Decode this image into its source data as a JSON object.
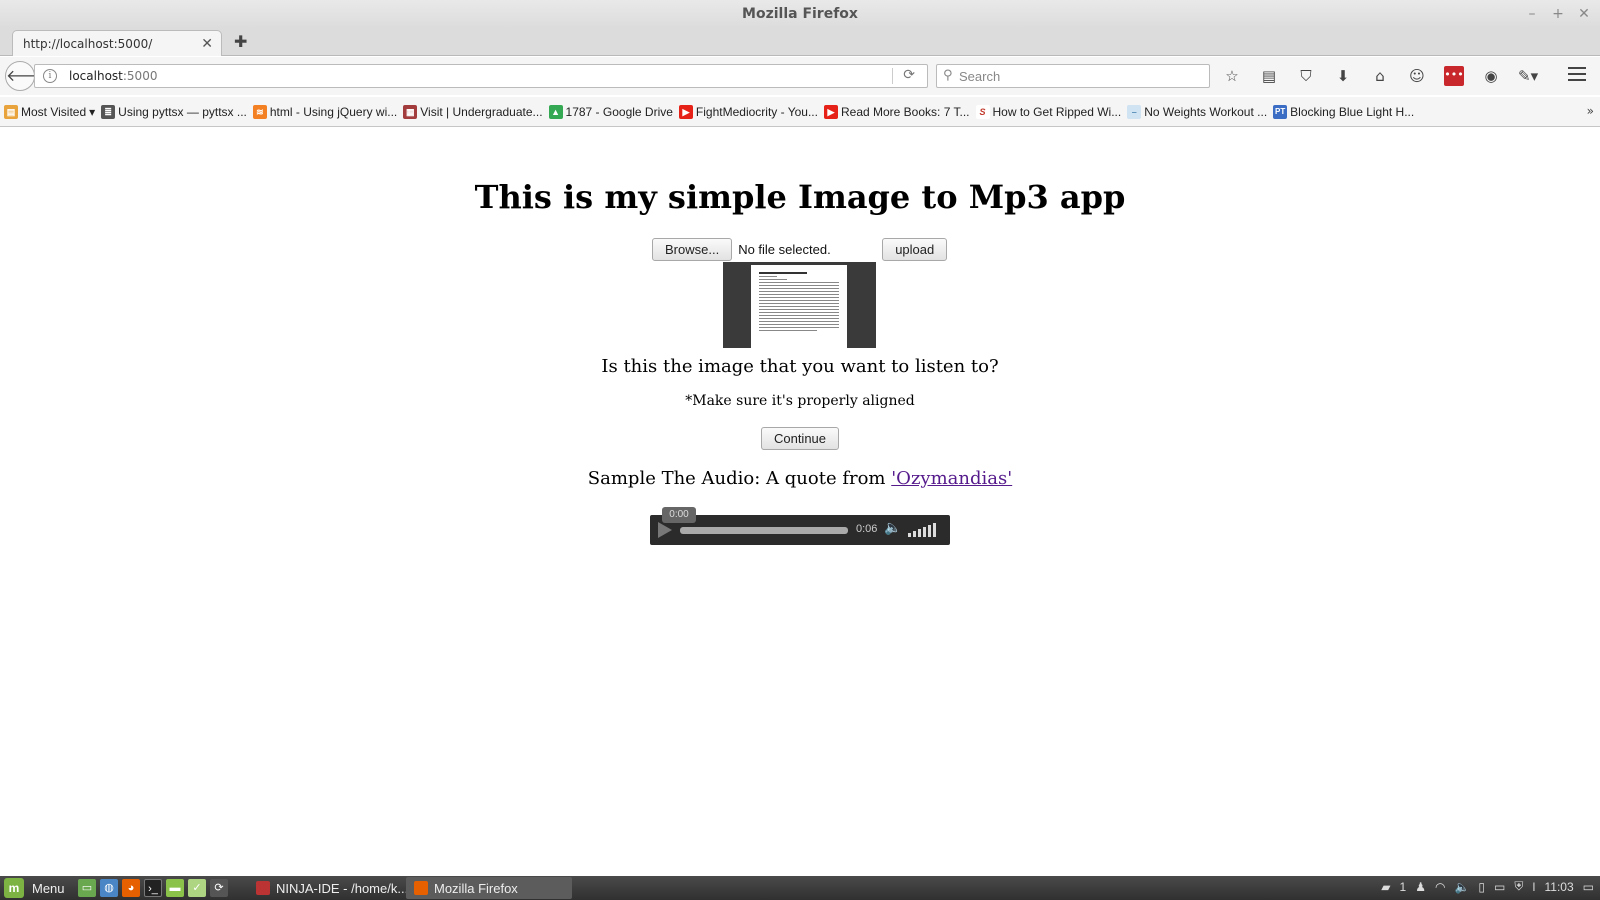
{
  "window": {
    "title": "Mozilla Firefox",
    "controls": [
      "–",
      "+",
      "✕"
    ]
  },
  "tabs": [
    {
      "label": "http://localhost:5000/",
      "close": "✕"
    }
  ],
  "new_tab": "✚",
  "navbar": {
    "url_host": "localhost",
    "url_port": ":5000",
    "search_placeholder": "Search",
    "icons": [
      "star-icon",
      "library-icon",
      "pocket-icon",
      "download-icon",
      "home-icon",
      "chat-icon",
      "addon-red-icon",
      "addon-green-icon",
      "extension-icon",
      "menu-icon"
    ]
  },
  "bookmarks": [
    {
      "label": "Most Visited",
      "color": "#e8a33c",
      "glyph": "▤"
    },
    {
      "label": "Using pyttsx — pyttsx ...",
      "color": "#555555",
      "glyph": "≣"
    },
    {
      "label": "html - Using jQuery wi...",
      "color": "#f48024",
      "glyph": "≋"
    },
    {
      "label": "Visit | Undergraduate...",
      "color": "#a33d3d",
      "glyph": "▦"
    },
    {
      "label": "1787 - Google Drive",
      "color": "#34a853",
      "glyph": "▲"
    },
    {
      "label": "FightMediocrity - You...",
      "color": "#e62117",
      "glyph": "▶"
    },
    {
      "label": "Read More Books: 7 T...",
      "color": "#e62117",
      "glyph": "▶"
    },
    {
      "label": "How to Get Ripped Wi...",
      "color": "#ffffff",
      "glyph": "S"
    },
    {
      "label": "No Weights Workout ...",
      "color": "#cfe3f2",
      "glyph": "–"
    },
    {
      "label": "Blocking Blue Light H...",
      "color": "#3b6dc4",
      "glyph": "PT"
    }
  ],
  "bookmarks_more": "»",
  "page": {
    "title": "This is my simple Image to Mp3 app",
    "browse_label": "Browse...",
    "file_status": "No file selected.",
    "upload_label": "upload",
    "question": "Is this the image that you want to listen to?",
    "note": "*Make sure it's properly aligned",
    "continue_label": "Continue",
    "sample_text": "Sample The Audio: A quote from ",
    "sample_link": "'Ozymandias'",
    "audio": {
      "current_time": "0:00",
      "duration": "0:06"
    }
  },
  "taskbar": {
    "menu_label": "Menu",
    "tasks": [
      {
        "label": "NINJA-IDE - /home/k...",
        "active": false
      },
      {
        "label": "Mozilla Firefox",
        "active": true
      }
    ],
    "notification_count": "1",
    "clock": "11:03"
  }
}
